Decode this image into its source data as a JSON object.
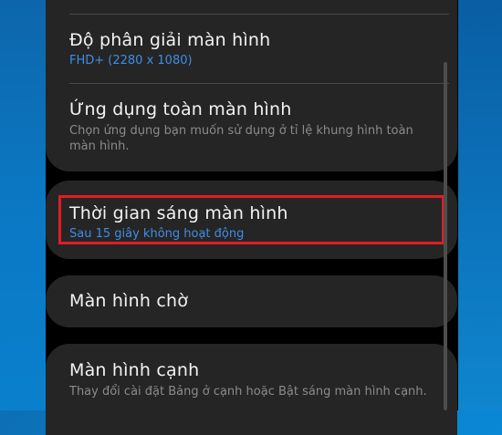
{
  "settings": {
    "resolution": {
      "title": "Độ phân giải màn hình",
      "value": "FHD+ (2280 x 1080)"
    },
    "fullscreen": {
      "title": "Ứng dụng toàn màn hình",
      "desc": "Chọn ứng dụng bạn muốn sử dụng ở tỉ lệ khung hình toàn màn hình."
    },
    "timeout": {
      "title": "Thời gian sáng màn hình",
      "value": "Sau 15 giây không hoạt động"
    },
    "screensaver": {
      "title": "Màn hình chờ"
    },
    "edge": {
      "title": "Màn hình cạnh",
      "desc": "Thay đổi cài đặt Bảng ở cạnh hoặc Bật sáng màn hình cạnh."
    }
  },
  "colors": {
    "accent": "#3e8ee6",
    "highlight": "#e11d22",
    "card": "#252525"
  }
}
